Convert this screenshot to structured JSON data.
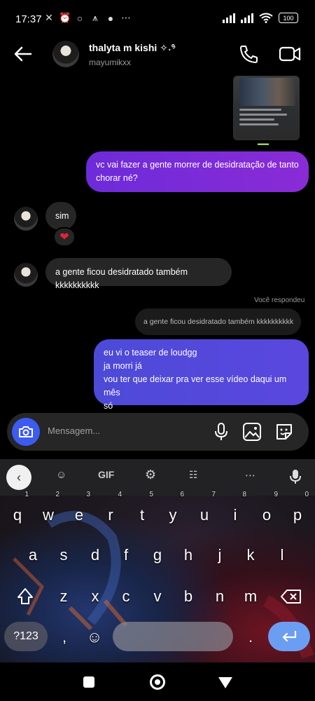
{
  "status_bar": {
    "time": "17:37",
    "battery": "100"
  },
  "header": {
    "contact_name": "thalyta m kishi ✧˖°",
    "username": "mayumikxx"
  },
  "messages": [
    {
      "from": "me",
      "text_lines": [
        "vc vai fazer a gente morrer de desidratação de tanto",
        "chorar né?"
      ]
    },
    {
      "from": "them",
      "text": "sim",
      "reaction": "❤"
    },
    {
      "from": "them",
      "text": "a gente ficou desidratado também kkkkkkkkkk"
    },
    {
      "from": "me",
      "reply_label": "Você respondeu",
      "quoted": "a gente ficou desidratado também kkkkkkkkkk",
      "text_lines": [
        "eu vi o teaser de loudgg",
        "ja morri já",
        "vou ter que deixar pra ver esse vídeo daqui um mês",
        "só"
      ]
    }
  ],
  "composer": {
    "placeholder": "Mensagem..."
  },
  "keyboard": {
    "toolbar": {
      "gif": "GIF"
    },
    "row1": [
      {
        "k": "q",
        "n": "1"
      },
      {
        "k": "w",
        "n": "2"
      },
      {
        "k": "e",
        "n": "3"
      },
      {
        "k": "r",
        "n": "4"
      },
      {
        "k": "t",
        "n": "5"
      },
      {
        "k": "y",
        "n": "6"
      },
      {
        "k": "u",
        "n": "7"
      },
      {
        "k": "i",
        "n": "8"
      },
      {
        "k": "o",
        "n": "9"
      },
      {
        "k": "p",
        "n": "0"
      }
    ],
    "row2": [
      "a",
      "s",
      "d",
      "f",
      "g",
      "h",
      "j",
      "k",
      "l"
    ],
    "row3": [
      "z",
      "x",
      "c",
      "v",
      "b",
      "n",
      "m"
    ],
    "symbols": "?123",
    "comma": ",",
    "period": "."
  },
  "colors": {
    "accent_purple": "#8a2bd6",
    "accent_blue": "#5a47de",
    "camera_button": "#3d5af1",
    "enter_key": "#6b9ef2"
  }
}
